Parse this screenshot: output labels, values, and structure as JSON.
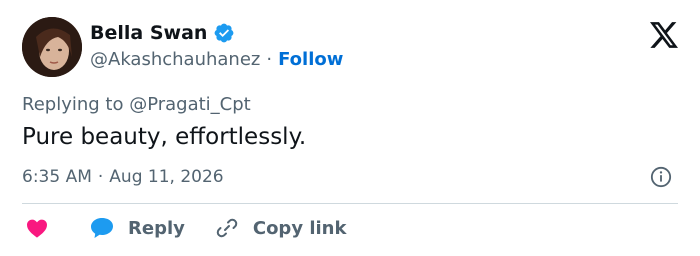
{
  "author": {
    "name": "Bella Swan",
    "handle": "@Akashchauhanez",
    "separator": "·",
    "follow_label": "Follow",
    "verified_color": "#1d9bf0"
  },
  "tweet": {
    "replying_to": "Replying to @Pragati_Cpt",
    "text": "Pure beauty, effortlessly.",
    "time": "6:35 AM",
    "separator": "·",
    "date": "Aug 11, 2026"
  },
  "actions": {
    "reply_label": "Reply",
    "copy_link_label": "Copy link",
    "like_color": "#f91880",
    "reply_color": "#1d9bf0"
  },
  "icons": [
    "x-logo-icon",
    "verified-badge-icon",
    "info-icon",
    "heart-icon",
    "reply-bubble-icon",
    "link-icon"
  ]
}
